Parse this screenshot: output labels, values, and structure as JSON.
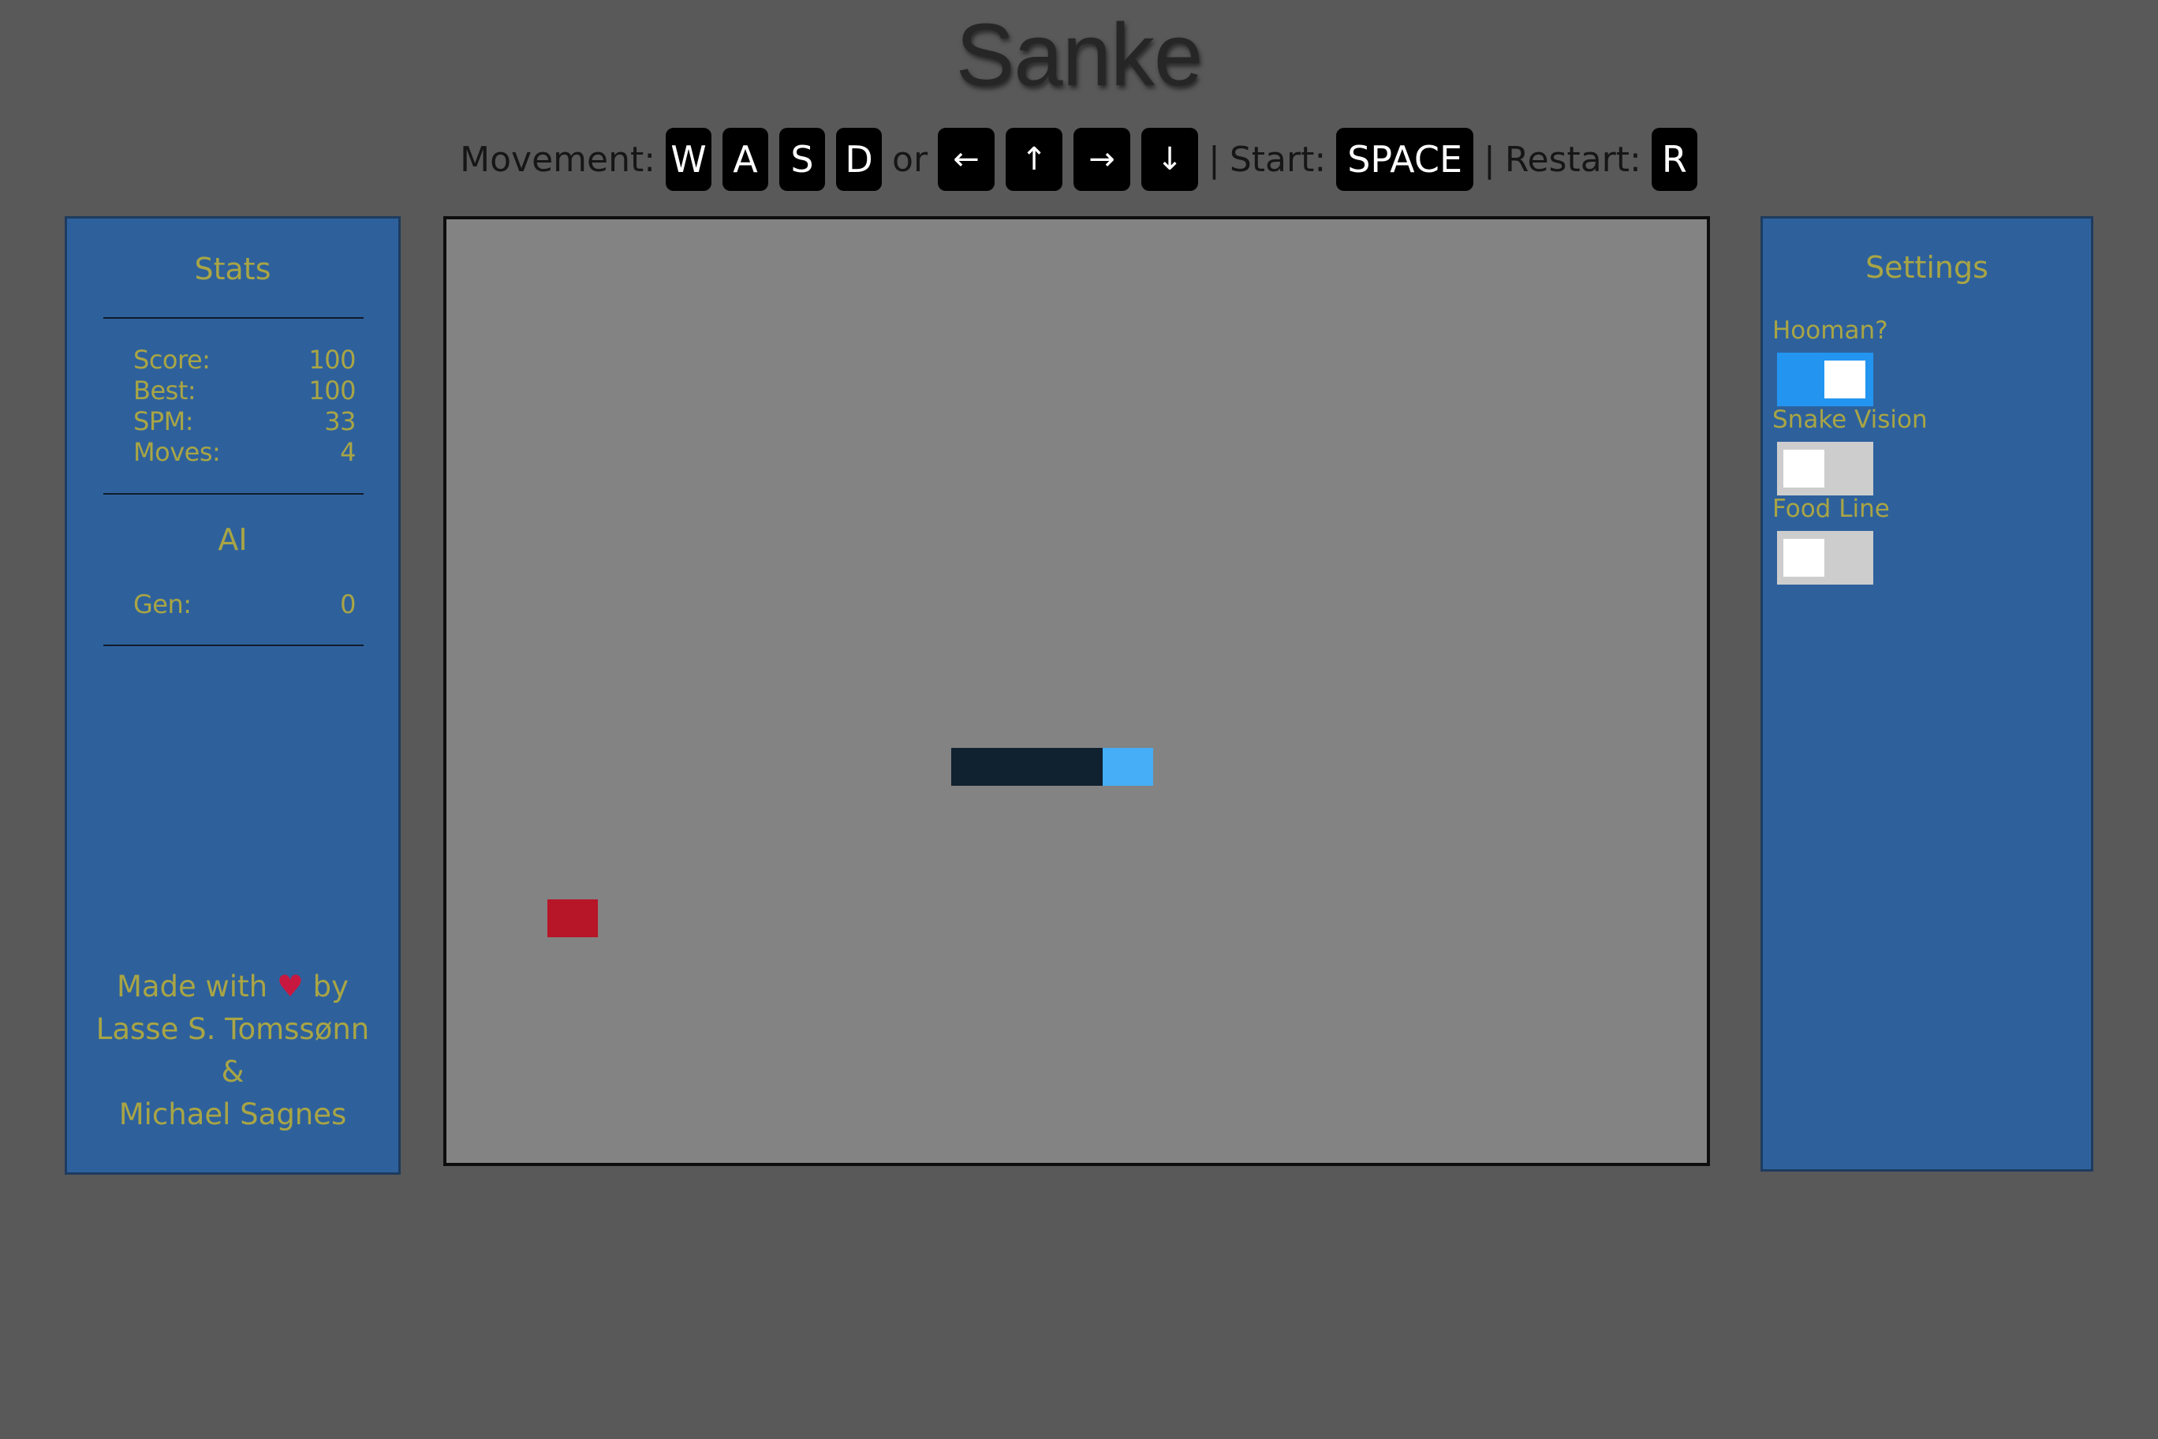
{
  "title": "Sanke",
  "controls": {
    "movement_label": "Movement:",
    "keys_wasd": [
      "W",
      "A",
      "S",
      "D"
    ],
    "or_label": "or",
    "keys_arrows": [
      "←",
      "↑",
      "→",
      "↓"
    ],
    "separator": "|",
    "start_label": "Start:",
    "start_key": "SPACE",
    "restart_label": "Restart:",
    "restart_key": "R"
  },
  "stats": {
    "heading": "Stats",
    "rows": [
      {
        "label": "Score:",
        "value": "100"
      },
      {
        "label": "Best:",
        "value": "100"
      },
      {
        "label": "SPM:",
        "value": "33"
      },
      {
        "label": "Moves:",
        "value": "4"
      }
    ],
    "ai_heading": "AI",
    "ai_rows": [
      {
        "label": "Gen:",
        "value": "0"
      }
    ]
  },
  "credits": {
    "made_with": "Made with",
    "heart_icon": "heart-icon",
    "by": "by",
    "author1": "Lasse S. Tomssønn",
    "amp": "&",
    "author2": "Michael Sagnes"
  },
  "settings": {
    "heading": "Settings",
    "items": [
      {
        "label": "Hooman?",
        "on": true
      },
      {
        "label": "Snake Vision",
        "on": false
      },
      {
        "label": "Food Line",
        "on": false
      }
    ]
  },
  "game": {
    "snake_direction": "right",
    "colors": {
      "board": "#838383",
      "snake_body": "#10212f",
      "snake_head": "#45aef6",
      "food": "#b71528"
    }
  }
}
